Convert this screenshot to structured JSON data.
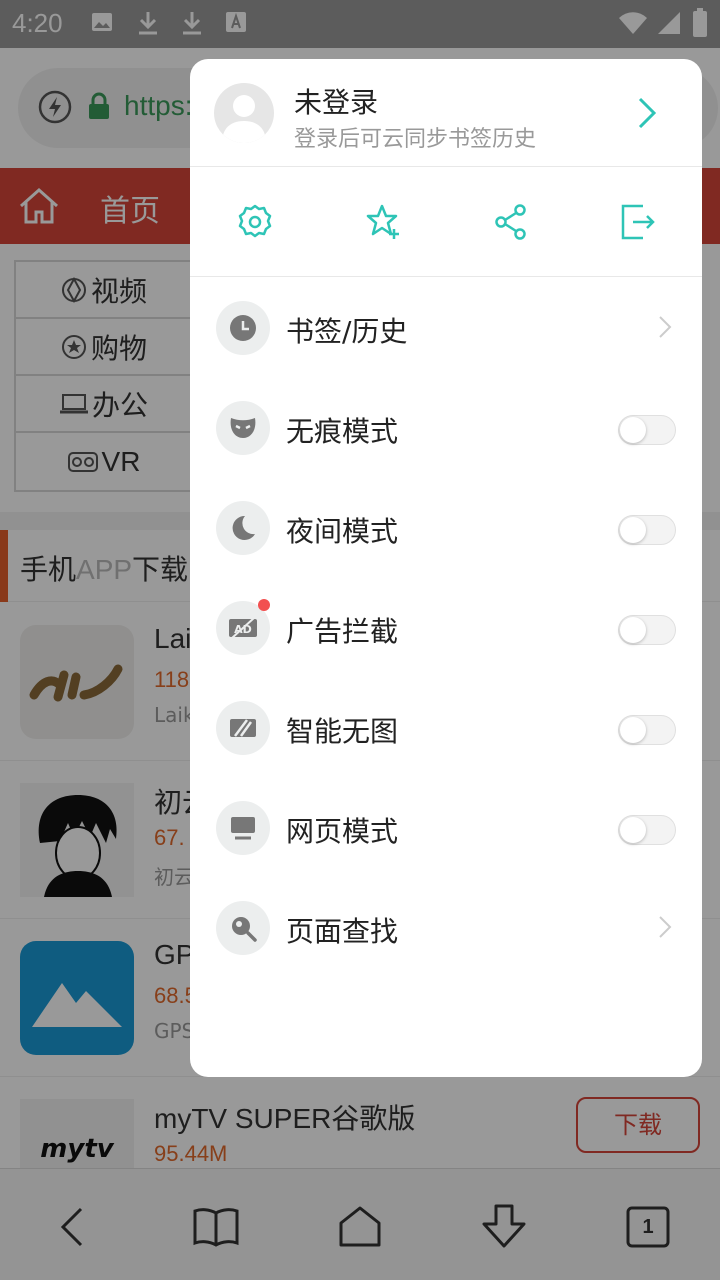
{
  "status_bar": {
    "time": "4:20"
  },
  "browser": {
    "url_text": "https:",
    "nav": {
      "home_label": "首页"
    },
    "categories": [
      {
        "label": "视频",
        "icon": "video-icon"
      },
      {
        "label": "购物",
        "icon": "shopping-icon"
      },
      {
        "label": "办公",
        "icon": "laptop-icon"
      },
      {
        "label": "VR",
        "icon": "vr-icon"
      }
    ],
    "section": {
      "title_cn_1": "手机",
      "title_en": "APP",
      "title_cn_2": "下载"
    },
    "apps": [
      {
        "name": "Lai",
        "size": "118",
        "sub": "Laik"
      },
      {
        "name": "初云",
        "size": "67.",
        "sub": "初云"
      },
      {
        "name": "GP",
        "size": "68.5",
        "sub": "GPS"
      },
      {
        "name": "myTV SUPER谷歌版",
        "size": "95.44M",
        "sub": "",
        "button": "下载"
      }
    ]
  },
  "menu": {
    "user": {
      "name": "未登录",
      "subtitle": "登录后可云同步书签历史"
    },
    "quick_actions": [
      "settings-icon",
      "add-bookmark-icon",
      "share-icon",
      "exit-icon"
    ],
    "items": [
      {
        "label": "书签/历史",
        "icon": "clock-icon",
        "control": "arrow"
      },
      {
        "label": "无痕模式",
        "icon": "incognito-mask-icon",
        "control": "toggle",
        "on": false
      },
      {
        "label": "夜间模式",
        "icon": "moon-icon",
        "control": "toggle",
        "on": false
      },
      {
        "label": "广告拦截",
        "icon": "ad-block-icon",
        "control": "toggle",
        "on": false,
        "badge": true
      },
      {
        "label": "智能无图",
        "icon": "no-image-icon",
        "control": "toggle",
        "on": false
      },
      {
        "label": "网页模式",
        "icon": "monitor-icon",
        "control": "toggle",
        "on": false
      },
      {
        "label": "页面查找",
        "icon": "search-icon",
        "control": "arrow"
      }
    ]
  },
  "bottom_bar": {
    "tab_count": "1"
  },
  "colors": {
    "accent": "#2ec4b6",
    "nav_red": "#d6453a",
    "size_orange": "#e26a2c"
  }
}
